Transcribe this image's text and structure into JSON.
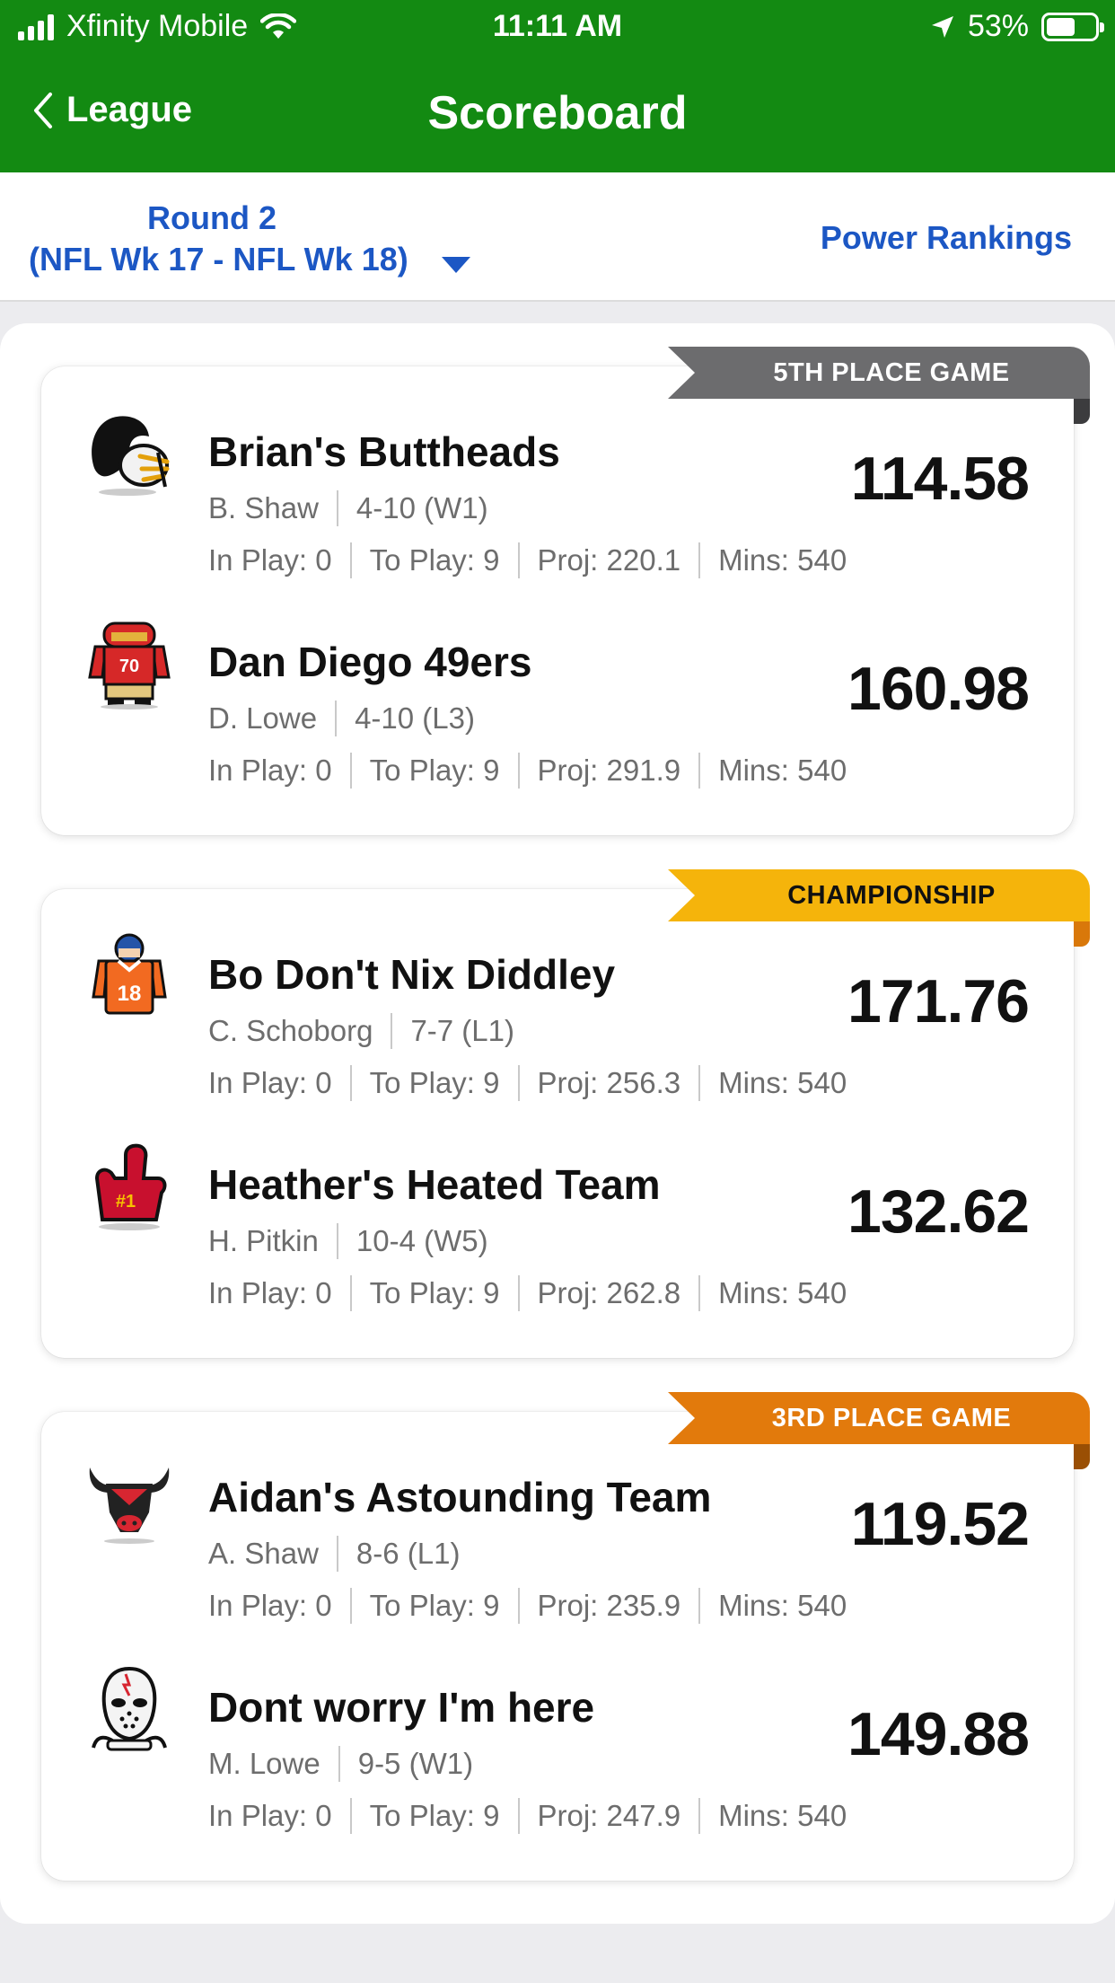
{
  "status_bar": {
    "carrier": "Xfinity Mobile",
    "time": "11:11 AM",
    "battery": "53%",
    "battery_level": 0.53
  },
  "nav": {
    "back_label": "League",
    "title": "Scoreboard"
  },
  "round_selector": {
    "line1": "Round 2",
    "line2": "(NFL Wk 17 - NFL Wk 18)"
  },
  "power_rankings": "Power Rankings",
  "colors": {
    "header_green": "#138a12",
    "link_blue": "#1c57c4",
    "banner_gray": "#6c6c6e",
    "banner_gold": "#f5b40b",
    "banner_orange": "#e27a0c"
  },
  "matchups": [
    {
      "banner": "5TH PLACE GAME",
      "teams": [
        {
          "name": "Brian's Buttheads",
          "owner": "B. Shaw",
          "record": "4-10 (W1)",
          "in_play": "In Play: 0",
          "to_play": "To Play: 9",
          "proj": "Proj: 220.1",
          "mins": "Mins: 540",
          "score": "114.58",
          "logo_icon": "helmet-pompadour-icon"
        },
        {
          "name": "Dan Diego 49ers",
          "owner": "D. Lowe",
          "record": "4-10 (L3)",
          "in_play": "In Play: 0",
          "to_play": "To Play: 9",
          "proj": "Proj: 291.9",
          "mins": "Mins: 540",
          "score": "160.98",
          "logo_icon": "jersey-70-icon"
        }
      ]
    },
    {
      "banner": "CHAMPIONSHIP",
      "teams": [
        {
          "name": "Bo Don't Nix Diddley",
          "owner": "C. Schoborg",
          "record": "7-7 (L1)",
          "in_play": "In Play: 0",
          "to_play": "To Play: 9",
          "proj": "Proj: 256.3",
          "mins": "Mins: 540",
          "score": "171.76",
          "logo_icon": "jersey-18-icon"
        },
        {
          "name": "Heather's Heated Team",
          "owner": "H. Pitkin",
          "record": "10-4 (W5)",
          "in_play": "In Play: 0",
          "to_play": "To Play: 9",
          "proj": "Proj: 262.8",
          "mins": "Mins: 540",
          "score": "132.62",
          "logo_icon": "foam-finger-icon"
        }
      ]
    },
    {
      "banner": "3RD PLACE GAME",
      "teams": [
        {
          "name": "Aidan's Astounding Team",
          "owner": "A. Shaw",
          "record": "8-6 (L1)",
          "in_play": "In Play: 0",
          "to_play": "To Play: 9",
          "proj": "Proj: 235.9",
          "mins": "Mins: 540",
          "score": "119.52",
          "logo_icon": "bull-head-icon"
        },
        {
          "name": "Dont worry I'm here",
          "owner": "M. Lowe",
          "record": "9-5 (W1)",
          "in_play": "In Play: 0",
          "to_play": "To Play: 9",
          "proj": "Proj: 247.9",
          "mins": "Mins: 540",
          "score": "149.88",
          "logo_icon": "hockey-mask-icon"
        }
      ]
    }
  ]
}
